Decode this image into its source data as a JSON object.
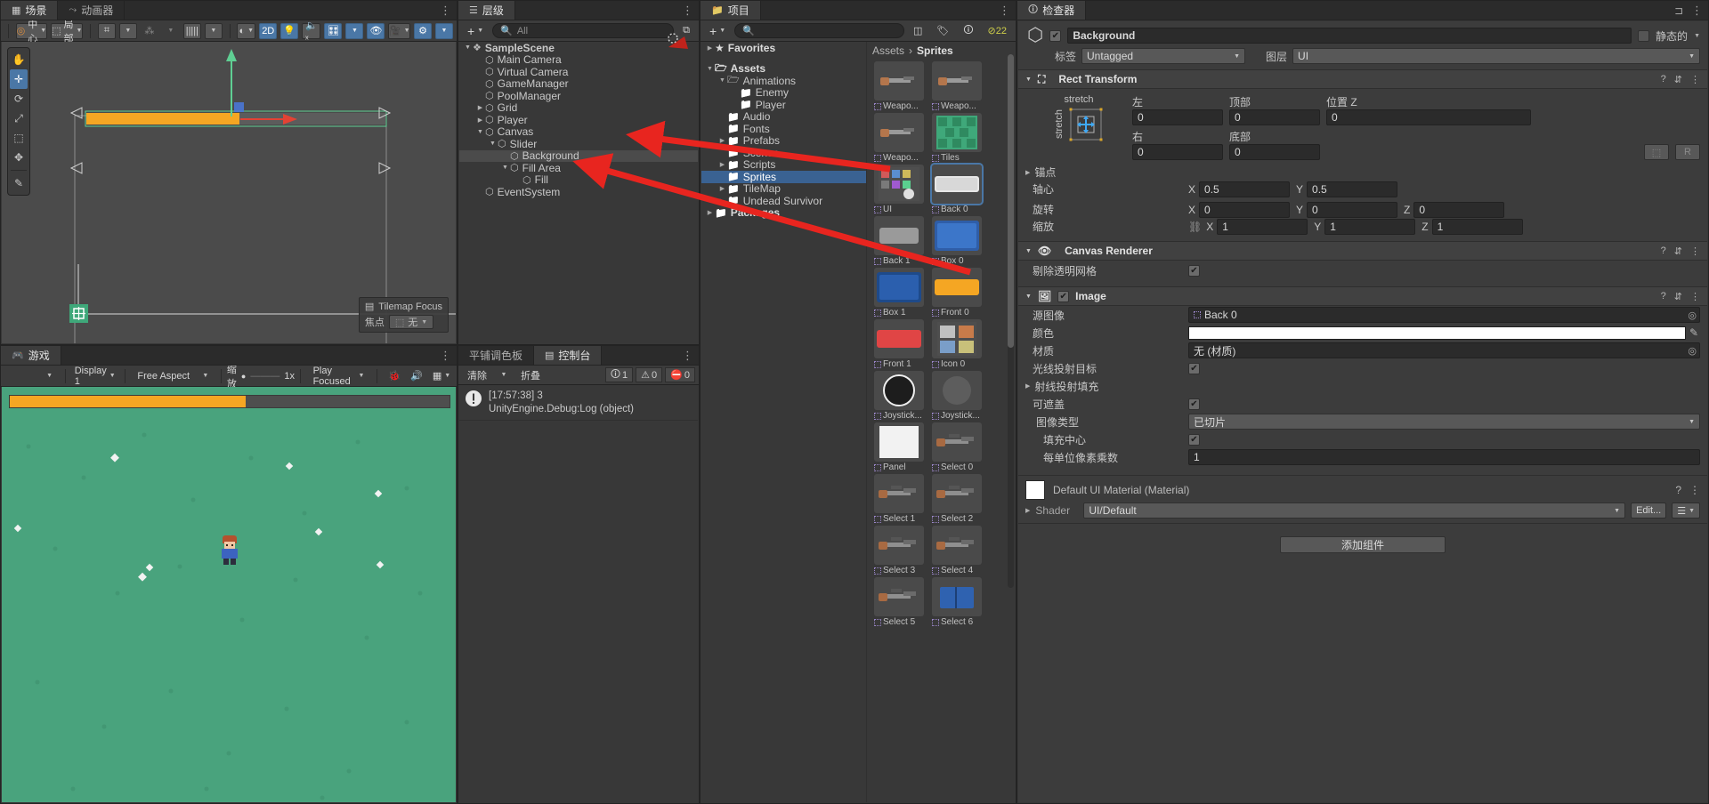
{
  "scene": {
    "tabs": [
      {
        "label": "场景",
        "icon": "grid-icon",
        "active": true
      },
      {
        "label": "动画器",
        "icon": "animator-icon",
        "active": false
      }
    ],
    "toolbar": {
      "pivot_mode": "中心",
      "handle_space": "局部",
      "mode_2d": "2D",
      "grid_icon": "grid-snap-icon",
      "snap_icon": "snap-increment-icon",
      "ruler_icon": "ruler-icon",
      "light_icon": "lighting-icon",
      "audio_icon": "audio-mute-icon",
      "fx_icon": "effects-icon",
      "shading_icon": "shading-mode-icon",
      "hidden_icon": "hidden-objects-icon",
      "camera_icon": "scene-camera-icon",
      "gizmos_icon": "gizmos-icon"
    },
    "tools": [
      "hand-tool",
      "move-tool",
      "rotate-tool",
      "scale-tool",
      "rect-tool",
      "transform-tool",
      "custom-tool"
    ],
    "focus_box": {
      "title": "Tilemap Focus",
      "label": "焦点",
      "value": "无"
    }
  },
  "game": {
    "tab": "游戏",
    "toolbar": {
      "display": "Display 1",
      "aspect": "Free Aspect",
      "scale_label": "缩放",
      "scale_value": "1x",
      "play_mode": "Play Focused",
      "stats_icon": "stats-icon",
      "mute_icon": "mute-audio-icon",
      "gizmos_icon": "gizmos-icon"
    }
  },
  "hierarchy": {
    "tab": "层级",
    "add_label": "+",
    "search_placeholder": "All",
    "items": [
      {
        "label": "SampleScene",
        "depth": 0,
        "arrow": "down",
        "icon": "scene-icon",
        "bold": true,
        "selected": false
      },
      {
        "label": "Main Camera",
        "depth": 1,
        "arrow": "",
        "icon": "gameobject-icon",
        "selected": false
      },
      {
        "label": "Virtual Camera",
        "depth": 1,
        "arrow": "",
        "icon": "gameobject-icon",
        "selected": false
      },
      {
        "label": "GameManager",
        "depth": 1,
        "arrow": "",
        "icon": "gameobject-icon",
        "selected": false
      },
      {
        "label": "PoolManager",
        "depth": 1,
        "arrow": "",
        "icon": "gameobject-icon",
        "selected": false
      },
      {
        "label": "Grid",
        "depth": 1,
        "arrow": "right",
        "icon": "gameobject-icon",
        "selected": false
      },
      {
        "label": "Player",
        "depth": 1,
        "arrow": "right",
        "icon": "gameobject-icon",
        "selected": false
      },
      {
        "label": "Canvas",
        "depth": 1,
        "arrow": "down",
        "icon": "gameobject-icon",
        "selected": false
      },
      {
        "label": "Slider",
        "depth": 2,
        "arrow": "down",
        "icon": "gameobject-icon",
        "selected": false
      },
      {
        "label": "Background",
        "depth": 3,
        "arrow": "",
        "icon": "gameobject-icon",
        "selected": true
      },
      {
        "label": "Fill Area",
        "depth": 3,
        "arrow": "down",
        "icon": "gameobject-icon",
        "selected": false
      },
      {
        "label": "Fill",
        "depth": 4,
        "arrow": "",
        "icon": "gameobject-icon",
        "selected": false
      },
      {
        "label": "EventSystem",
        "depth": 1,
        "arrow": "",
        "icon": "gameobject-icon",
        "selected": false
      }
    ]
  },
  "console": {
    "tabs": [
      {
        "label": "平铺调色板",
        "active": false
      },
      {
        "label": "控制台",
        "active": true,
        "icon": "console-icon"
      }
    ],
    "toolbar": {
      "clear": "清除",
      "collapse": "折叠"
    },
    "counts": {
      "log": "1",
      "warning": "0",
      "error": "0"
    },
    "entries": [
      {
        "icon": "log-icon",
        "line1": "[17:57:38] 3",
        "line2": "UnityEngine.Debug:Log (object)"
      }
    ]
  },
  "project": {
    "tab": "项目",
    "add_label": "+",
    "search_placeholder": "",
    "breadcrumb": [
      "Assets",
      "Sprites"
    ],
    "tree": [
      {
        "label": "Favorites",
        "depth": 0,
        "arrow": "right",
        "icon": "star-icon",
        "bold": true,
        "selected": false
      },
      {
        "label": "",
        "depth": 0,
        "arrow": "",
        "icon": "",
        "spacer": true
      },
      {
        "label": "Assets",
        "depth": 0,
        "arrow": "down",
        "icon": "folder-open-icon",
        "bold": true,
        "selected": false
      },
      {
        "label": "Animations",
        "depth": 1,
        "arrow": "down",
        "icon": "folder-open-icon",
        "selected": false
      },
      {
        "label": "Enemy",
        "depth": 2,
        "arrow": "",
        "icon": "folder-icon",
        "selected": false
      },
      {
        "label": "Player",
        "depth": 2,
        "arrow": "",
        "icon": "folder-icon",
        "selected": false
      },
      {
        "label": "Audio",
        "depth": 1,
        "arrow": "",
        "icon": "folder-icon",
        "selected": false
      },
      {
        "label": "Fonts",
        "depth": 1,
        "arrow": "",
        "icon": "folder-icon",
        "selected": false
      },
      {
        "label": "Prefabs",
        "depth": 1,
        "arrow": "right",
        "icon": "folder-icon",
        "selected": false
      },
      {
        "label": "Scenes",
        "depth": 1,
        "arrow": "",
        "icon": "folder-icon",
        "selected": false
      },
      {
        "label": "Scripts",
        "depth": 1,
        "arrow": "right",
        "icon": "folder-icon",
        "selected": false
      },
      {
        "label": "Sprites",
        "depth": 1,
        "arrow": "",
        "icon": "folder-icon",
        "selected": true
      },
      {
        "label": "TileMap",
        "depth": 1,
        "arrow": "right",
        "icon": "folder-icon",
        "selected": false
      },
      {
        "label": "Undead Survivor",
        "depth": 1,
        "arrow": "right",
        "icon": "folder-icon",
        "selected": false
      },
      {
        "label": "Packages",
        "depth": 0,
        "arrow": "right",
        "icon": "folder-icon",
        "bold": true,
        "selected": false
      }
    ],
    "assets": [
      [
        {
          "label": "Weapo...",
          "kind": "gun-sprite",
          "selected": false
        },
        {
          "label": "Weapo...",
          "kind": "gun-sprite",
          "selected": false
        }
      ],
      [
        {
          "label": "Weapo...",
          "kind": "gun-sprite",
          "selected": false
        },
        {
          "label": "Tiles",
          "kind": "tiles-sprite",
          "selected": false
        }
      ],
      [
        {
          "label": "UI",
          "kind": "ui-sheet-sprite",
          "selected": false
        },
        {
          "label": "Back 0",
          "kind": "back0-sprite",
          "selected": true
        }
      ],
      [
        {
          "label": "Back 1",
          "kind": "back1-sprite",
          "selected": false
        },
        {
          "label": "Box 0",
          "kind": "box0-sprite",
          "selected": false
        }
      ],
      [
        {
          "label": "Box 1",
          "kind": "box1-sprite",
          "selected": false
        },
        {
          "label": "Front 0",
          "kind": "front0-sprite",
          "selected": false
        }
      ],
      [
        {
          "label": "Front 1",
          "kind": "front1-sprite",
          "selected": false
        },
        {
          "label": "Icon 0",
          "kind": "icon0-sprite",
          "selected": false
        }
      ],
      [
        {
          "label": "Joystick...",
          "kind": "joystick-outer-sprite",
          "selected": false
        },
        {
          "label": "Joystick...",
          "kind": "joystick-inner-sprite",
          "selected": false
        }
      ],
      [
        {
          "label": "Panel",
          "kind": "panel-sprite",
          "selected": false
        },
        {
          "label": "Select 0",
          "kind": "select-gun-sprite",
          "selected": false
        }
      ],
      [
        {
          "label": "Select 1",
          "kind": "select-gun-sprite",
          "selected": false
        },
        {
          "label": "Select 2",
          "kind": "select-gun-sprite",
          "selected": false
        }
      ],
      [
        {
          "label": "Select 3",
          "kind": "select-gun-sprite",
          "selected": false
        },
        {
          "label": "Select 4",
          "kind": "select-gun-sprite",
          "selected": false
        }
      ],
      [
        {
          "label": "Select 5",
          "kind": "select-gun-sprite",
          "selected": false
        },
        {
          "label": "Select 6",
          "kind": "select-book-sprite",
          "selected": false
        }
      ]
    ]
  },
  "inspector": {
    "tab": "检查器",
    "enabled": true,
    "object_name": "Background",
    "static_label": "静态的",
    "static_checked": false,
    "tag_label": "标签",
    "tag_value": "Untagged",
    "layer_label": "图层",
    "layer_value": "UI",
    "rect_transform": {
      "title": "Rect Transform",
      "anchor_preset": "stretch",
      "anchor_preset_v": "stretch",
      "left_label": "左",
      "left": "0",
      "top_label": "顶部",
      "top": "0",
      "posz_label": "位置 Z",
      "posz": "0",
      "right_label": "右",
      "right": "0",
      "bottom_label": "底部",
      "bottom": "0",
      "blueprint_label": "R",
      "anchors_label": "锚点",
      "pivot_label": "轴心",
      "pivot_x": "0.5",
      "pivot_y": "0.5",
      "rotation_label": "旋转",
      "rot_x": "0",
      "rot_y": "0",
      "rot_z": "0",
      "scale_label": "缩放",
      "scale_x": "1",
      "scale_y": "1",
      "scale_z": "1"
    },
    "canvas_renderer": {
      "title": "Canvas Renderer",
      "cull_label": "剔除透明网格",
      "cull_checked": true
    },
    "image": {
      "title": "Image",
      "enabled": true,
      "source_label": "源图像",
      "source_value": "Back 0",
      "color_label": "颜色",
      "color_value": "#FFFFFF",
      "material_label": "材质",
      "material_value": "无 (材质)",
      "raycast_label": "光线投射目标",
      "raycast_checked": true,
      "raycast_padding_label": "射线投射填充",
      "maskable_label": "可遮盖",
      "maskable_checked": true,
      "image_type_label": "图像类型",
      "image_type_value": "已切片",
      "fill_center_label": "填充中心",
      "fill_center_checked": true,
      "ppu_label": "每单位像素乘数",
      "ppu_value": "1"
    },
    "material": {
      "title": "Default UI Material (Material)",
      "shader_label": "Shader",
      "shader_value": "UI/Default",
      "edit_label": "Edit..."
    },
    "add_component": "添加组件"
  },
  "colors": {
    "accent_blue": "#4a77a6",
    "select_blue": "#3a6292",
    "panel_bg": "#383838",
    "header_bg": "#3c3c3c",
    "arrow_red": "#e8251f",
    "game_green": "#49a37d",
    "slider_orange": "#f5a623"
  }
}
